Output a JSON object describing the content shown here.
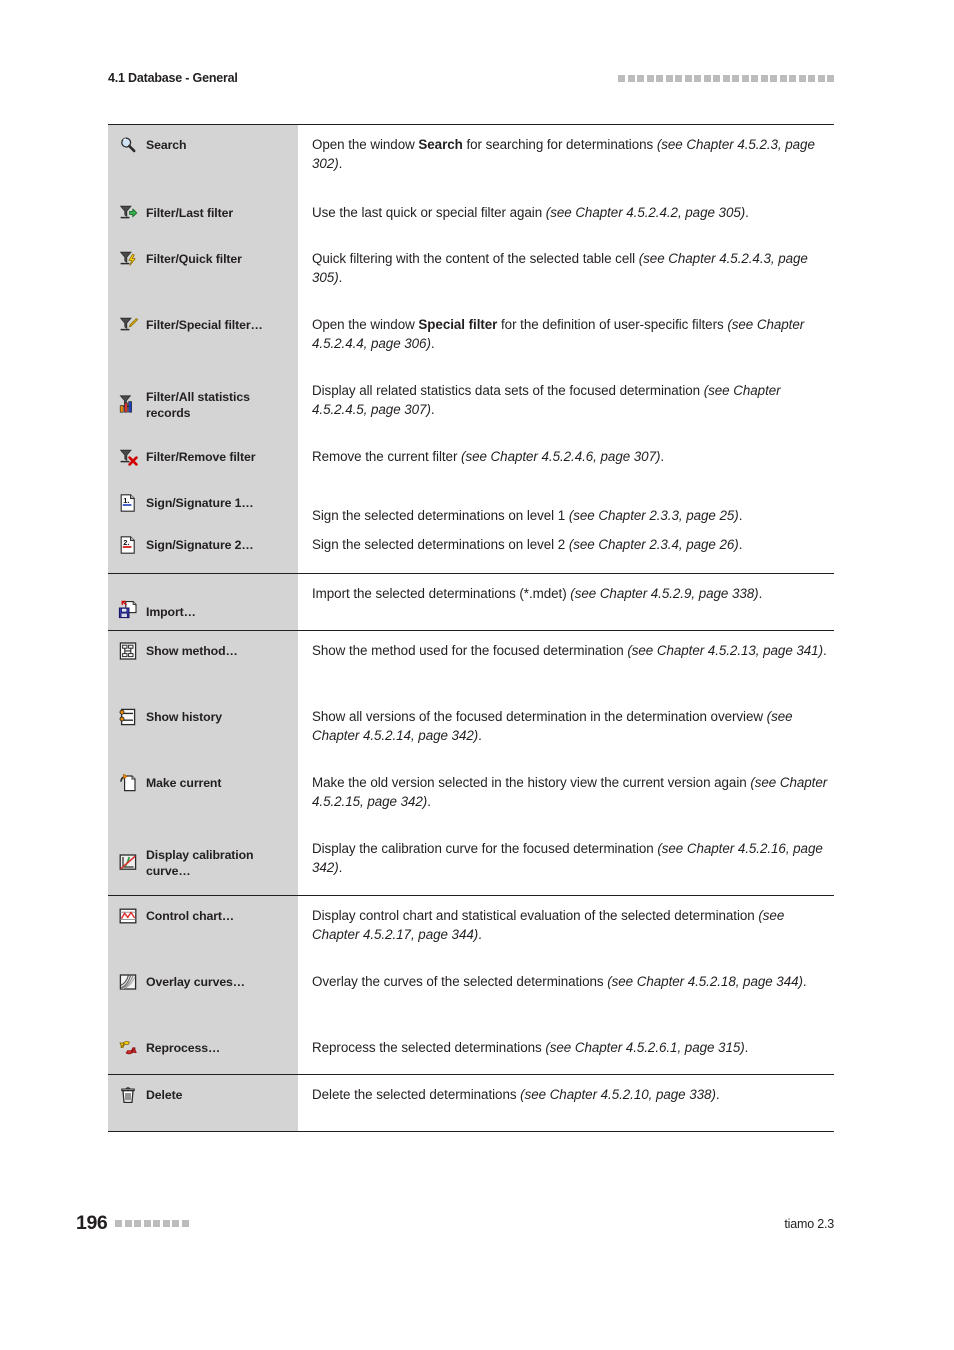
{
  "header": {
    "title": "4.1 Database - General",
    "decoration_squares": 23,
    "decoration_color": "#bcbcbc"
  },
  "footer": {
    "page_number": "196",
    "decoration_squares": 8,
    "product": "tiamo 2.3"
  },
  "table": {
    "left_column_bg": "#d4d4d4",
    "groups": [
      {
        "rows": [
          {
            "icon": "search-magnifier-icon",
            "label": "Search",
            "label_align": "top",
            "desc_html": "Open the window <b>Search</b> for searching for determinations <i>(see Chapter 4.5.2.3, page 302)</i>.",
            "desc_plain": "Open the window Search for searching for determinations (see Chapter 4.5.2.3, page 302)."
          },
          {
            "icon": "filter-last-filter-icon",
            "label": "Filter/Last filter",
            "label_align": "top",
            "desc_html": "Use the last quick or special filter again <i>(see Chapter 4.5.2.4.2, page 305)</i>.",
            "desc_plain": "Use the last quick or special filter again (see Chapter 4.5.2.4.2, page 305)."
          },
          {
            "icon": "filter-quick-filter-icon",
            "label": "Filter/Quick filter",
            "label_align": "top",
            "desc_html": "Quick filtering with the content of the selected table cell <i>(see Chapter 4.5.2.4.3, page 305)</i>.",
            "desc_plain": "Quick filtering with the content of the selected table cell (see Chapter 4.5.2.4.3, page 305)."
          },
          {
            "icon": "filter-special-filter-icon",
            "label": "Filter/Special filter…",
            "label_align": "top",
            "desc_html": "Open the window <b>Special filter</b> for the definition of user-specific filters <i>(see Chapter 4.5.2.4.4, page 306)</i>.",
            "desc_plain": "Open the window Special filter for the definition of user-specific filters (see Chapter 4.5.2.4.4, page 306)."
          },
          {
            "icon": "filter-all-statistics-records-icon",
            "label": "Filter/All statistics records",
            "label_align": "center",
            "desc_html": "Display all related statistics data sets of the focused determination <i>(see Chapter 4.5.2.4.5, page 307)</i>.",
            "desc_plain": "Display all related statistics data sets of the focused determination (see Chapter 4.5.2.4.5, page 307)."
          },
          {
            "icon": "filter-remove-filter-icon",
            "label": "Filter/Remove filter",
            "label_align": "top",
            "desc_html": "Remove the current filter <i>(see Chapter 4.5.2.4.6, page 307)</i>.",
            "desc_plain": "Remove the current filter (see Chapter 4.5.2.4.6, page 307)."
          },
          {
            "icon": "sign-signature-1-icon",
            "label": "Sign/Signature 1…",
            "label_align": "top",
            "desc_html": "Sign the selected determinations on level 1 <i>(see Chapter 2.3.3, page 25)</i>.",
            "desc_plain": "Sign the selected determinations on level 1 (see Chapter 2.3.3, page 25).",
            "desc_align": "bottom"
          },
          {
            "icon": "sign-signature-2-icon",
            "label": "Sign/Signature 2…",
            "label_align": "top",
            "desc_html": "Sign the selected determinations on level 2 <i>(see Chapter 2.3.4, page 26)</i>.",
            "desc_plain": "Sign the selected determinations on level 2 (see Chapter 2.3.4, page 26)."
          }
        ]
      },
      {
        "rows": [
          {
            "icon": "import-icon",
            "label": "Import…",
            "label_align": "bottom",
            "desc_html": "Import the selected determinations (*.mdet) <i>(see Chapter 4.5.2.9, page 338)</i>.",
            "desc_plain": "Import the selected determinations (*.mdet) (see Chapter 4.5.2.9, page 338)."
          }
        ]
      },
      {
        "rows": [
          {
            "icon": "show-method-icon",
            "label": "Show method…",
            "label_align": "top",
            "desc_html": "Show the method used for the focused determination <i>(see Chapter 4.5.2.13, page 341)</i>.",
            "desc_plain": "Show the method used for the focused determination (see Chapter 4.5.2.13, page 341)."
          },
          {
            "icon": "show-history-icon",
            "label": "Show history",
            "label_align": "top",
            "desc_html": "Show all versions of the focused determination in the determination overview <i>(see Chapter 4.5.2.14, page 342)</i>.",
            "desc_plain": "Show all versions of the focused determination in the determination overview (see Chapter 4.5.2.14, page 342)."
          },
          {
            "icon": "make-current-icon",
            "label": "Make current",
            "label_align": "top",
            "desc_html": "Make the old version selected in the history view the current version again <i>(see Chapter 4.5.2.15, page 342)</i>.",
            "desc_plain": "Make the old version selected in the history view the current version again (see Chapter 4.5.2.15, page 342)."
          },
          {
            "icon": "display-calibration-curve-icon",
            "label": "Display calibration curve…",
            "label_align": "center",
            "desc_html": "Display the calibration curve for the focused determination <i>(see Chapter 4.5.2.16, page 342)</i>.",
            "desc_plain": "Display the calibration curve for the focused determination (see Chapter 4.5.2.16, page 342)."
          }
        ]
      },
      {
        "rows": [
          {
            "icon": "control-chart-icon",
            "label": "Control chart…",
            "label_align": "top",
            "desc_html": "Display control chart and statistical evaluation of the selected determination <i>(see Chapter 4.5.2.17, page 344)</i>.",
            "desc_plain": "Display control chart and statistical evaluation of the selected determination (see Chapter 4.5.2.17, page 344)."
          },
          {
            "icon": "overlay-curves-icon",
            "label": "Overlay curves…",
            "label_align": "top",
            "desc_html": "Overlay the curves of the selected determinations <i>(see Chapter 4.5.2.18, page 344)</i>.",
            "desc_plain": "Overlay the curves of the selected determinations (see Chapter 4.5.2.18, page 344)."
          },
          {
            "icon": "reprocess-icon",
            "label": "Reprocess…",
            "label_align": "top",
            "desc_html": "Reprocess the selected determinations <i>(see Chapter 4.5.2.6.1, page 315)</i>.",
            "desc_plain": "Reprocess the selected determinations (see Chapter 4.5.2.6.1, page 315)."
          }
        ]
      },
      {
        "rows": [
          {
            "icon": "delete-trash-icon",
            "label": "Delete",
            "label_align": "top",
            "desc_html": "Delete the selected determinations <i>(see Chapter 4.5.2.10, page 338)</i>.",
            "desc_plain": "Delete the selected determinations (see Chapter 4.5.2.10, page 338)."
          }
        ]
      }
    ]
  }
}
